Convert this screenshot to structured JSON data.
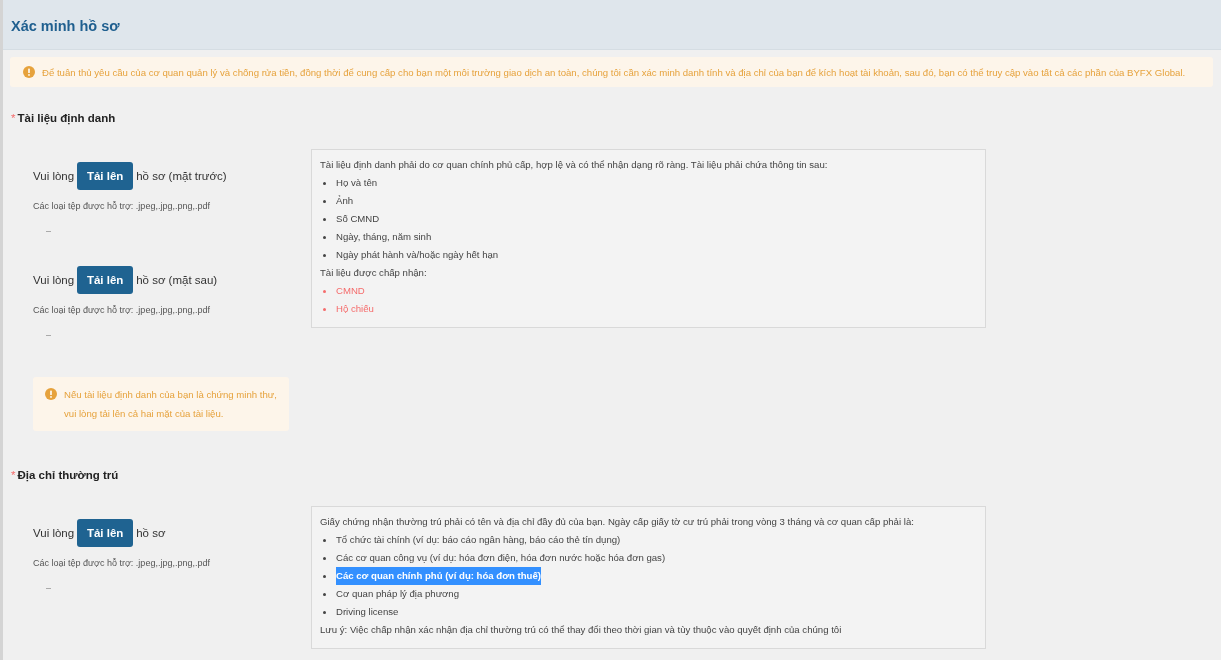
{
  "header": {
    "title": "Xác minh hồ sơ"
  },
  "notice": "Để tuân thủ yêu cầu của cơ quan quản lý và chống rửa tiền, đồng thời để cung cấp cho bạn một môi trường giao dịch an toàn, chúng tôi cần xác minh danh tính và địa chỉ của bạn để kích hoạt tài khoản, sau đó, bạn có thể truy cập vào tất cả các phần của BYFX Global.",
  "sections": [
    {
      "required_mark": "*",
      "title": "Tài liệu định danh",
      "uploads": [
        {
          "prefix": "Vui lòng",
          "button": "Tải lên",
          "suffix": "hồ sơ (mặt trước)",
          "hint": "Các loại tệp được hỗ trợ: .jpeg,.jpg,.png,.pdf"
        },
        {
          "prefix": "Vui lòng",
          "button": "Tải lên",
          "suffix": "hồ sơ (mặt sau)",
          "hint": "Các loại tệp được hỗ trợ: .jpeg,.jpg,.png,.pdf"
        }
      ],
      "warning": "Nếu tài liệu định danh của bạn là chứng minh thư, vui lòng tải lên cả hai mặt của tài liệu.",
      "info": {
        "intro": "Tài liệu định danh phải do cơ quan chính phủ cấp, hợp lệ và có thể nhận dạng rõ ràng. Tài liệu phải chứa thông tin sau:",
        "items": [
          {
            "text": "Họ và tên",
            "highlighted": false
          },
          {
            "text": "Ảnh",
            "highlighted": false
          },
          {
            "text": "Số CMND",
            "highlighted": false
          },
          {
            "text": "Ngày, tháng, năm sinh",
            "highlighted": false
          },
          {
            "text": "Ngày phát hành và/hoặc ngày hết hạn",
            "highlighted": false
          }
        ],
        "accepted_label": "Tài liệu được chấp nhận:",
        "accepted": [
          "CMND",
          "Hộ chiếu"
        ]
      }
    },
    {
      "required_mark": "*",
      "title": "Địa chỉ thường trú",
      "uploads": [
        {
          "prefix": "Vui lòng",
          "button": "Tải lên",
          "suffix": "hồ sơ",
          "hint": "Các loại tệp được hỗ trợ: .jpeg,.jpg,.png,.pdf"
        }
      ],
      "info": {
        "intro": "Giấy chứng nhận thường trú phải có tên và địa chỉ đầy đủ của bạn. Ngày cấp giấy tờ cư trú phải trong vòng 3 tháng và cơ quan cấp phải là:",
        "items": [
          {
            "text": "Tổ chức tài chính (ví dụ: báo cáo ngân hàng, báo cáo thẻ tín dụng)",
            "highlighted": false
          },
          {
            "text": "Các cơ quan công vụ (ví dụ: hóa đơn điện, hóa đơn nước hoặc hóa đơn gas)",
            "highlighted": false
          },
          {
            "text": "Các cơ quan chính phủ (ví dụ: hóa đơn thuế)",
            "highlighted": true
          },
          {
            "text": "Cơ quan pháp lý địa phương",
            "highlighted": false
          },
          {
            "text": "Driving license",
            "highlighted": false
          }
        ],
        "note": "Lưu ý: Việc chấp nhận xác nhận địa chỉ thường trú có thể thay đổi theo thời gian và tùy thuộc vào quyết định của chúng tôi"
      }
    }
  ]
}
